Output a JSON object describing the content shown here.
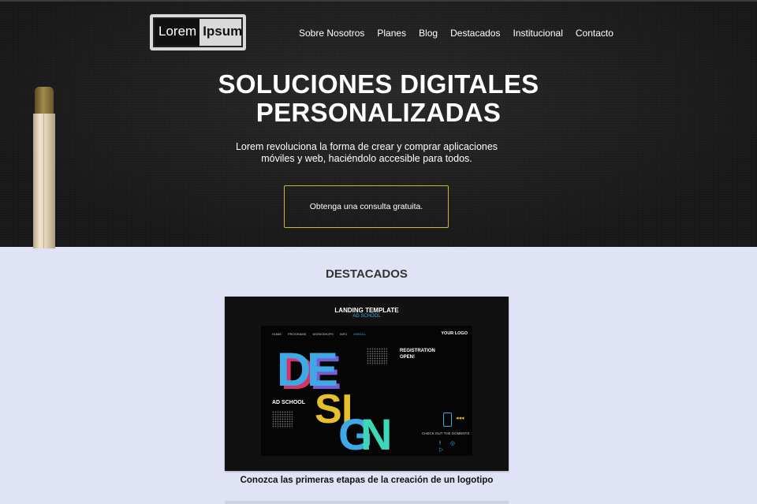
{
  "header": {
    "logo": {
      "part1": "Lorem",
      "part2": "Ipsum"
    },
    "nav": [
      "Sobre Nosotros",
      "Planes",
      "Blog",
      "Destacados",
      "Institucional",
      "Contacto"
    ]
  },
  "hero": {
    "title_line1": "SOLUCIONES DIGITALES",
    "title_line2": "PERSONALIZADAS",
    "subtitle": "Lorem revoluciona la forma de crear y comprar aplicaciones móviles y web, haciéndolo accesible para todos.",
    "cta": "Obtenga una consulta gratuita."
  },
  "featured": {
    "title": "DESTACADOS",
    "card": {
      "image": {
        "heading": "LANDING TEMPLATE",
        "subheading": "AD SCHOOL",
        "nav": [
          "HOME",
          "PROGRAMS",
          "WORKSHOPS",
          "INFO",
          "ENROLL"
        ],
        "logo": "YOUR LOGO",
        "registration": "REGISTRATION OPEN!",
        "design_word": "DESIGN",
        "letters": [
          "D",
          "E",
          "S",
          "I",
          "G",
          "N"
        ],
        "school": "AD SCHOOL",
        "check": "CHECK OUT THE DOMENTS",
        "colors": {
          "cyan": "#3fa9e6",
          "yellow": "#e5c02a",
          "teal": "#3fd6b8",
          "pink": "#d6336c"
        }
      },
      "caption": "Conozca las primeras etapas de la creación de un logotipo"
    }
  },
  "colors": {
    "hero_bg": "#1f1f1f",
    "page_bg": "#e0e3f5",
    "cta_border": "#c9b73a"
  }
}
